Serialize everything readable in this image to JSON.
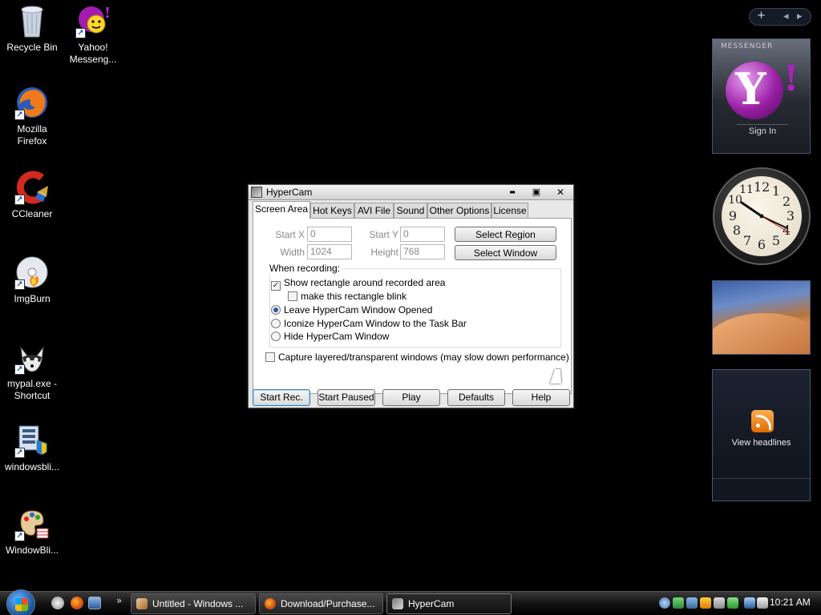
{
  "desktop_icons": [
    {
      "label": "Recycle Bin",
      "icon": "recycle-bin-icon"
    },
    {
      "label": "Yahoo!\nMesseng...",
      "icon": "yahoo-messenger-icon"
    },
    {
      "label": "Mozilla\nFirefox",
      "icon": "firefox-icon"
    },
    {
      "label": "CCleaner",
      "icon": "ccleaner-icon"
    },
    {
      "label": "ImgBurn",
      "icon": "imgburn-icon"
    },
    {
      "label": "mypal.exe -\nShortcut",
      "icon": "mypal-icon"
    },
    {
      "label": "windowsbli...",
      "icon": "windowsblinds-icon"
    },
    {
      "label": "WindowBli...",
      "icon": "windowblinds-paint-icon"
    }
  ],
  "gadgets": {
    "sidebar_controls": {
      "add": "+",
      "prev": "◂",
      "next": "▸"
    },
    "messenger": {
      "brand": "MESSENGER",
      "sign_in": "Sign In"
    },
    "clock": {
      "numbers": [
        "12",
        "1",
        "2",
        "3",
        "4",
        "5",
        "6",
        "7",
        "8",
        "9",
        "10",
        "11"
      ],
      "time": "10:21"
    },
    "feed": {
      "label": "View headlines"
    }
  },
  "window": {
    "title": "HyperCam",
    "controls": {
      "minimize": "▬",
      "maximize": "▣",
      "close": "✕"
    },
    "tabs": [
      "Screen Area",
      "Hot Keys",
      "AVI File",
      "Sound",
      "Other Options",
      "License"
    ],
    "active_tab": "Screen Area",
    "fields": {
      "start_x_label": "Start X",
      "start_x": "0",
      "start_y_label": "Start Y",
      "start_y": "0",
      "width_label": "Width",
      "width": "1024",
      "height_label": "Height",
      "height": "768"
    },
    "select_region": "Select Region",
    "select_window": "Select Window",
    "when_recording": "When recording:",
    "options": {
      "show_rect": {
        "label": "Show rectangle around recorded area",
        "checked": true
      },
      "blink": {
        "label": "make this rectangle blink",
        "checked": false
      },
      "leave_open": {
        "label": "Leave HyperCam Window Opened",
        "selected": true
      },
      "iconize": {
        "label": "Iconize HyperCam Window to the Task Bar",
        "selected": false
      },
      "hide": {
        "label": "Hide HyperCam Window",
        "selected": false
      },
      "layered": {
        "label": "Capture layered/transparent windows (may slow down performance)",
        "checked": false
      }
    },
    "buttons": [
      "Start Rec.",
      "Start Paused",
      "Play",
      "Defaults",
      "Help"
    ]
  },
  "taskbar": {
    "tasks": [
      {
        "label": "Untitled - Windows ...",
        "active": false
      },
      {
        "label": "Download/Purchase...",
        "active": false
      },
      {
        "label": "HyperCam",
        "active": true
      }
    ],
    "chevron": "»",
    "clock": "10:21 AM"
  },
  "colors": {
    "desktop": "#000000",
    "window_bg": "#e8e8e8",
    "accent": "#1b5ea8"
  }
}
